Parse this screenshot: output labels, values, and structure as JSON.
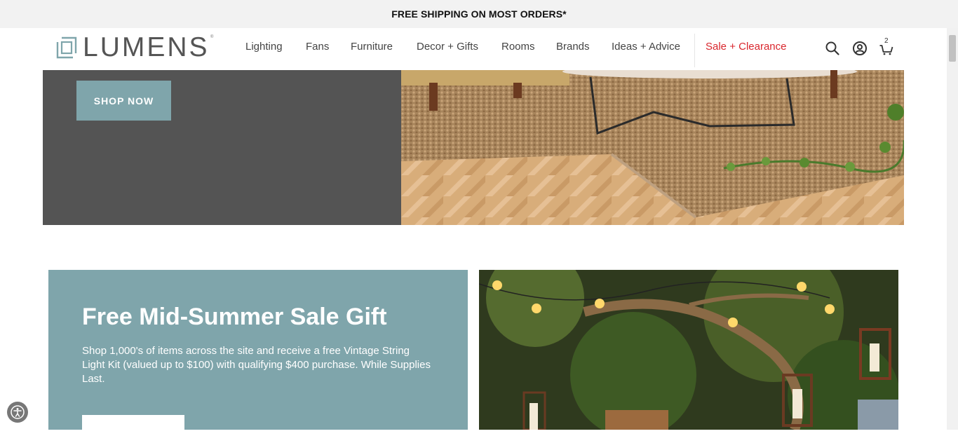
{
  "promo_bar": {
    "text": "FREE SHIPPING ON MOST ORDERS*"
  },
  "brand": {
    "name": "LUMENS",
    "tm": "®"
  },
  "nav": {
    "items": [
      {
        "label": "Lighting"
      },
      {
        "label": "Fans"
      },
      {
        "label": "Furniture"
      },
      {
        "label": "Decor + Gifts"
      },
      {
        "label": "Rooms"
      },
      {
        "label": "Brands"
      },
      {
        "label": "Ideas + Advice"
      }
    ],
    "sale": {
      "label": "Sale + Clearance"
    }
  },
  "header_icons": {
    "search": "search-icon",
    "account": "account-icon",
    "cart": "cart-icon",
    "cart_count": "2"
  },
  "hero": {
    "button_label": "SHOP NOW"
  },
  "promo": {
    "title": "Free Mid-Summer Sale Gift",
    "body": "Shop 1,000's of items across the site and receive a free Vintage String Light Kit (valued up to $100) with qualifying $400 purchase. While Supplies Last."
  },
  "colors": {
    "accent": "#7fa5ab",
    "sale": "#d9262d",
    "hero_panel": "#545454",
    "promo_bar": "#f2f2f2"
  }
}
